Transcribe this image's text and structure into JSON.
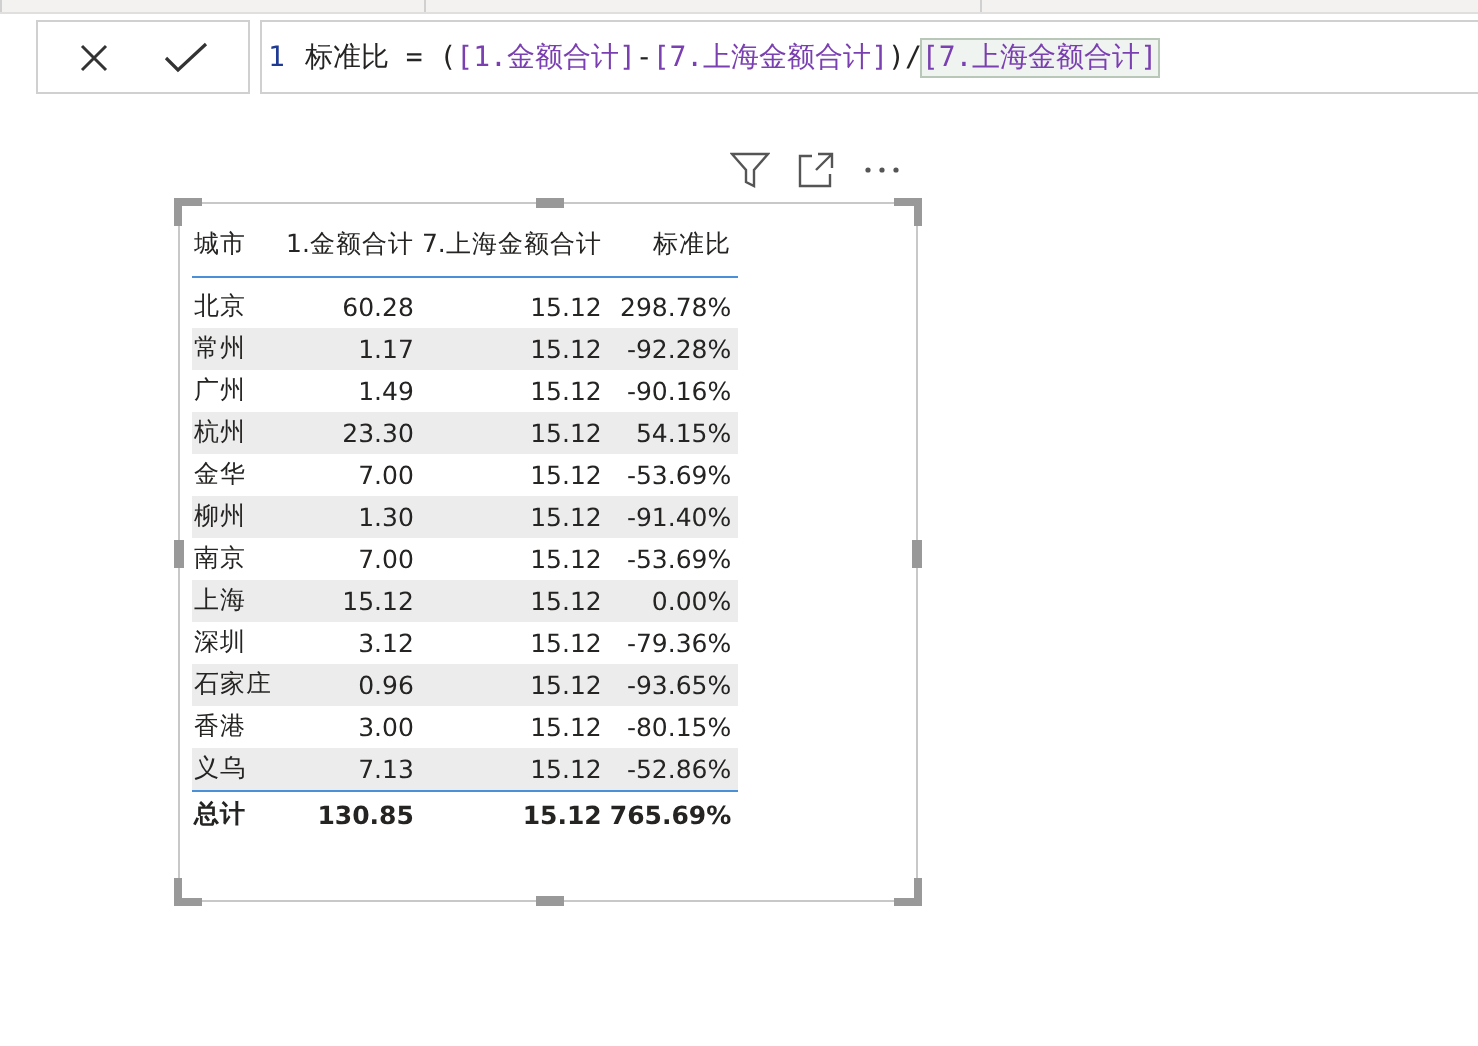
{
  "formula_bar": {
    "line_number": "1",
    "tokens": [
      {
        "kind": "text",
        "text": "标准比 = ("
      },
      {
        "kind": "ref",
        "text": "[1.金额合计]"
      },
      {
        "kind": "text",
        "text": "-"
      },
      {
        "kind": "ref",
        "text": "[7.上海金额合计]"
      },
      {
        "kind": "text",
        "text": ")/"
      },
      {
        "kind": "matched",
        "text": "[7.上海金额合计]"
      }
    ]
  },
  "table": {
    "columns": [
      "城市",
      "1.金额合计",
      "7.上海金额合计",
      "标准比"
    ],
    "rows": [
      [
        "北京",
        "60.28",
        "15.12",
        "298.78%"
      ],
      [
        "常州",
        "1.17",
        "15.12",
        "-92.28%"
      ],
      [
        "广州",
        "1.49",
        "15.12",
        "-90.16%"
      ],
      [
        "杭州",
        "23.30",
        "15.12",
        "54.15%"
      ],
      [
        "金华",
        "7.00",
        "15.12",
        "-53.69%"
      ],
      [
        "柳州",
        "1.30",
        "15.12",
        "-91.40%"
      ],
      [
        "南京",
        "7.00",
        "15.12",
        "-53.69%"
      ],
      [
        "上海",
        "15.12",
        "15.12",
        "0.00%"
      ],
      [
        "深圳",
        "3.12",
        "15.12",
        "-79.36%"
      ],
      [
        "石家庄",
        "0.96",
        "15.12",
        "-93.65%"
      ],
      [
        "香港",
        "3.00",
        "15.12",
        "-80.15%"
      ],
      [
        "义乌",
        "7.13",
        "15.12",
        "-52.86%"
      ]
    ],
    "total": [
      "总计",
      "130.85",
      "15.12",
      "765.69%"
    ]
  }
}
